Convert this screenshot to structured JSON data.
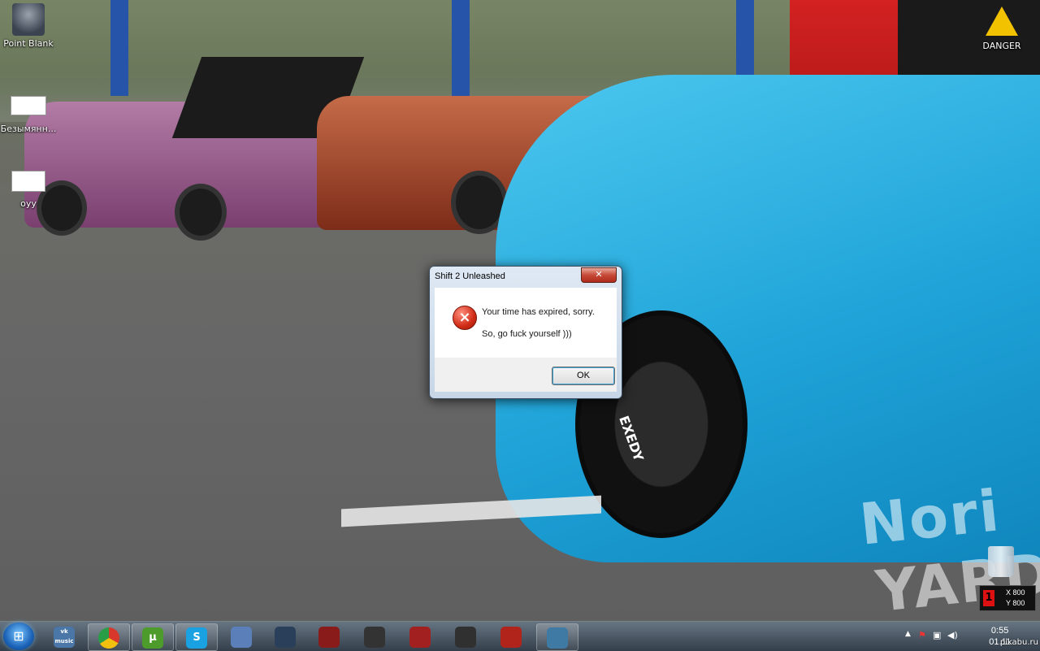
{
  "desktop_icons": [
    {
      "label": "Point Blank"
    },
    {
      "label": "Безымянн..."
    },
    {
      "label": "оуу"
    },
    {
      "label": "DANGER"
    }
  ],
  "wallpaper": {
    "watermark_line1": "Nori",
    "watermark_line2": "YARD",
    "car_wheel_brand": "EXEDY"
  },
  "dialog": {
    "title": "Shift 2 Unleashed",
    "close_glyph": "✕",
    "message_line1": "Your time has expired, sorry.",
    "message_line2": "So, go fuck yourself )))",
    "ok_label": "OK"
  },
  "xy_widget": {
    "badge": "1",
    "x_label": "X 800",
    "y_label": "Y 800"
  },
  "taskbar": {
    "start_glyph": "⊞",
    "apps": [
      {
        "icon": "vk-music-icon",
        "label": "vk music",
        "color": "#4a76a8"
      },
      {
        "icon": "chrome-icon",
        "label": "",
        "color": "#d8372b"
      },
      {
        "icon": "utorrent-icon",
        "label": "µ",
        "color": "#4d9b2a"
      },
      {
        "icon": "skype-icon",
        "label": "S",
        "color": "#1aa1e2"
      },
      {
        "icon": "launcher-icon",
        "label": "",
        "color": "#5b7fb8"
      },
      {
        "icon": "steam-icon",
        "label": "",
        "color": "#2a3f5a"
      },
      {
        "icon": "bloody-icon",
        "label": "",
        "color": "#8a1b1b"
      },
      {
        "icon": "nfs-icon",
        "label": "",
        "color": "#333333"
      },
      {
        "icon": "game-icon",
        "label": "",
        "color": "#a32020"
      },
      {
        "icon": "shield-game-icon",
        "label": "",
        "color": "#303030"
      },
      {
        "icon": "dota2-icon",
        "label": "",
        "color": "#b0241b"
      },
      {
        "icon": "window-icon",
        "label": "",
        "color": "#3f7aa5"
      }
    ],
    "tray_arrow": "▲",
    "clock_time": "0:55",
    "clock_date": "01.11",
    "pikabu": "pikabu.ru"
  }
}
